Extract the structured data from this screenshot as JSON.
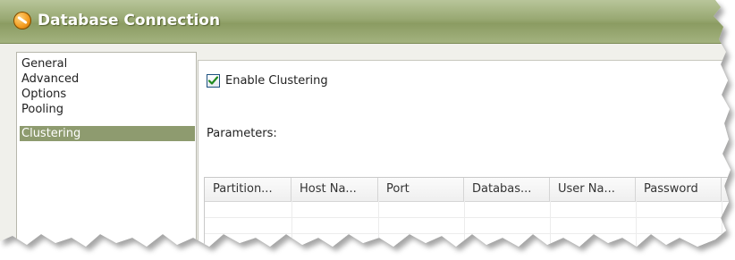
{
  "window": {
    "title": "Database Connection"
  },
  "nav": {
    "items": [
      {
        "label": "General",
        "selected": false
      },
      {
        "label": "Advanced",
        "selected": false
      },
      {
        "label": "Options",
        "selected": false
      },
      {
        "label": "Pooling",
        "selected": false
      },
      {
        "label": "Clustering",
        "selected": true
      }
    ]
  },
  "clustering": {
    "enable_label": "Enable Clustering",
    "enable_checked": true,
    "parameters_label": "Parameters:"
  },
  "table": {
    "columns": [
      "Partition...",
      "Host Na...",
      "Port",
      "Databas...",
      "User Na...",
      "Password"
    ],
    "rows": []
  },
  "colors": {
    "titlebar": "#98a872",
    "selection": "#8e9b6f",
    "checkmark": "#1f8a1f"
  }
}
